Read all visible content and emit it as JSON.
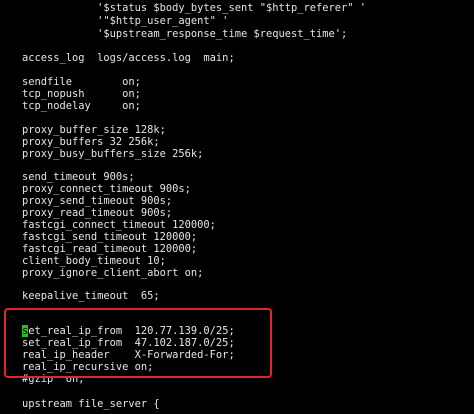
{
  "terminal": {
    "background_color": "#000000",
    "text_color": "#e6e6e6",
    "cursor_color": "#22c322",
    "highlight_border_color": "#e0252b",
    "lines": [
      "            '$status $body_bytes_sent \"$http_referer\" '",
      "            '\"$http_user_agent\" '",
      "            '$upstream_response_time $request_time';",
      "",
      "access_log  logs/access.log  main;",
      "",
      "sendfile        on;",
      "tcp_nopush      on;",
      "tcp_nodelay     on;",
      "",
      "proxy_buffer_size 128k;",
      "proxy_buffers 32 256k;",
      "proxy_busy_buffers_size 256k;",
      "",
      "send_timeout 900s;",
      "proxy_connect_timeout 900s;",
      "proxy_send_timeout 900s;",
      "proxy_read_timeout 900s;",
      "fastcgi_connect_timeout 120000;",
      "fastcgi_send_timeout 120000;",
      "fastcgi_read_timeout 120000;",
      "client_body_timeout 10;",
      "proxy_ignore_client_abort on;",
      "",
      "keepalive_timeout  65;",
      "",
      "",
      "et_real_ip_from  120.77.139.0/25;",
      "set_real_ip_from  47.102.187.0/25;",
      "real_ip_header    X-Forwarded-For;",
      "real_ip_recursive on;",
      "#gzip  on;",
      "",
      "upstream file_server {"
    ],
    "cursor_char": "s",
    "cursor_line_index": 27
  }
}
